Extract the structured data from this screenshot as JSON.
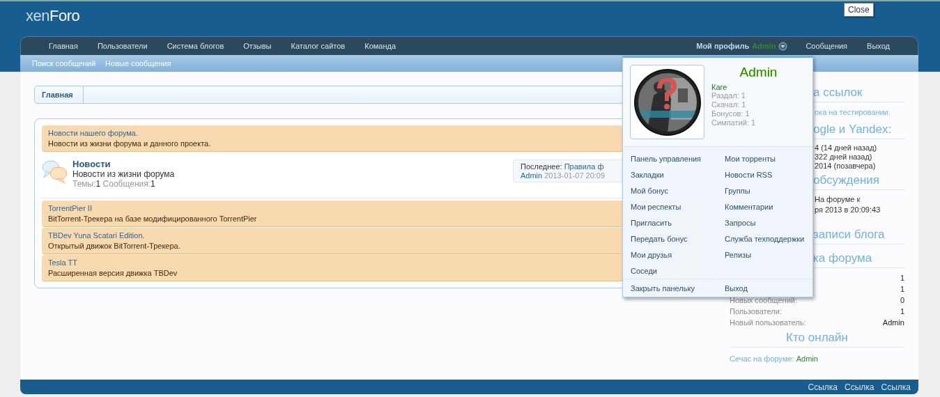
{
  "logo": {
    "light": "xen",
    "bold": "Foro"
  },
  "close_tooltip": "Close",
  "nav": {
    "items": [
      "Главная",
      "Пользователи",
      "Система блогов",
      "Отзывы",
      "Каталог сайтов",
      "Команда"
    ],
    "profile": {
      "label": "Мой профиль",
      "user": "Admin",
      "expanded": true
    },
    "right": [
      "Сообщения",
      "Выход"
    ]
  },
  "subnav": [
    "Поиск сообщений",
    "Новые сообщения"
  ],
  "breadcrumb": [
    "Главная"
  ],
  "forum_list": [
    {
      "kind": "category",
      "title": "Новости нашего форума.",
      "description": "Новости из жизни форума и данного проекта."
    },
    {
      "kind": "forum",
      "title": "Новости",
      "description": "Новости из жизни форума",
      "threads_label": "Темы:",
      "threads": "1",
      "posts_label": "Сообщения:",
      "posts": "1",
      "last_label": "Последнее:",
      "last_title": "Правила ф",
      "last_user": "Admin",
      "last_date": "2013-01-07 20:09"
    },
    {
      "kind": "category",
      "title": "TorrentPier II",
      "description": "BitTorrent-Трекера на базе модифицированного TorrentPier"
    },
    {
      "kind": "category",
      "title": "TBDev Yuna Scatari Edition.",
      "description": "Открытый движок BitTorrent-Трекера."
    },
    {
      "kind": "category",
      "title": "Tesla TT",
      "description": "Расширенная версия движка TBDev"
    }
  ],
  "sidebar": [
    {
      "kind": "heading",
      "text": "а ссылок",
      "partly_hidden": true
    },
    {
      "kind": "note",
      "text": "ока на тестировании.",
      "partly_hidden": true
    },
    {
      "kind": "heading",
      "text": "ogle и Yandex:",
      "partly_hidden": true
    },
    {
      "kind": "line",
      "text": "4 (14 дней назад)",
      "partly_hidden": true
    },
    {
      "kind": "line",
      "text": "322 дней назад)",
      "partly_hidden": true
    },
    {
      "kind": "line",
      "text": "2014 (позавчера)",
      "partly_hidden": true
    },
    {
      "kind": "heading",
      "text": "обсуждения",
      "partly_hidden": true
    },
    {
      "kind": "post",
      "lines": [
        "На форуме к",
        "ря 2013 в 20:09:43"
      ],
      "partly_hidden": true
    },
    {
      "kind": "heading",
      "text": "записи блога",
      "partly_hidden": true
    },
    {
      "kind": "heading",
      "text": "ка форума",
      "partly_hidden": true
    },
    {
      "kind": "stat",
      "value": "1"
    },
    {
      "kind": "stat",
      "value": "1"
    },
    {
      "kind": "stat",
      "label": "Новых сообщений:",
      "value": "0"
    },
    {
      "kind": "stat",
      "label": "Пользователи:",
      "value": "1"
    },
    {
      "kind": "stat",
      "label": "Новый пользователь:",
      "value": "Admin"
    },
    {
      "kind": "heading",
      "text": "Кто онлайн",
      "partly_hidden": false
    },
    {
      "kind": "online",
      "label": "Сечас на форуме:",
      "user": "Admin"
    }
  ],
  "profile_popup": {
    "name": "Admin",
    "title": "Каге",
    "stats": [
      "Раздал: 1",
      "Скачал: 1",
      "Бонусов: 1",
      "Симпатий: 1"
    ],
    "links_left": [
      "Панель управления",
      "Закладки",
      "Мой бонус",
      "Мои респекты",
      "Пригласить",
      "Передать бонус",
      "Мои друзья",
      "Соседи"
    ],
    "links_right": [
      "Мои торренты",
      "Новости RSS",
      "Группы",
      "Комментарии",
      "Запросы",
      "Служба техподдержки",
      "Релизы"
    ],
    "bottom_left": "Закрыть панельку",
    "bottom_right": "Выход"
  },
  "footer_links": [
    "Ссылка",
    "Ссылка",
    "Ссылка"
  ]
}
